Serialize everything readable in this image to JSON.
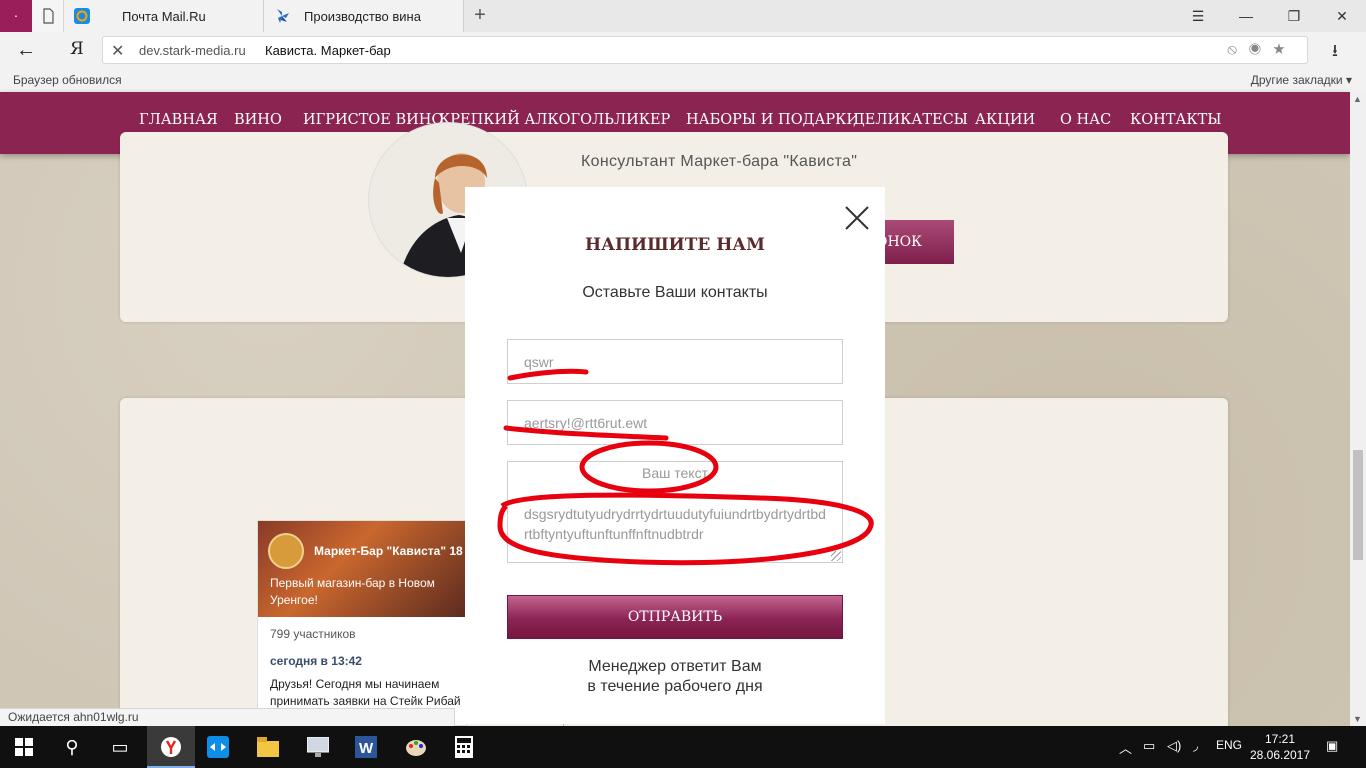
{
  "browser": {
    "tabs": [
      {
        "label": "Почта Mail.Ru",
        "icon": "mail-ru-icon"
      },
      {
        "label": "Производство вина",
        "icon": "pinwheel-icon"
      }
    ],
    "address": {
      "domain": "dev.stark-media.ru",
      "page_title": "Кависта. Маркет-бар"
    },
    "info_left": "Браузер обновился",
    "info_right": "Другие закладки"
  },
  "site": {
    "nav": [
      "ГЛАВНАЯ",
      "ВИНО",
      "ИГРИСТОЕ ВИНО",
      "КРЕПКИЙ АЛКОГОЛЬ",
      "ЛИКЕР",
      "НАБОРЫ И ПОДАРКИ",
      "ДЕЛИКАТЕСЫ",
      "АКЦИИ",
      "О НАС",
      "КОНТАКТЫ"
    ],
    "consultant": "Консультант Маркет-бара \"Кависта\"",
    "callback_button": "ОНОК",
    "vk_widget": {
      "name": "Маркет-Бар \"Кависта\" 18",
      "description": "Первый магазин-бар в Новом Уренгое!",
      "members": "799 участников",
      "date": "сегодня в 13:42",
      "post": "Друзья! Сегодня мы начинаем принимать заявки на Стейк Рибай"
    }
  },
  "modal": {
    "title": "НАПИШИТЕ НАМ",
    "subtitle": "Оставьте Ваши контакты",
    "name_value": "qswr",
    "email_value": "aertsry!@rtt6rut.ewt",
    "text_placeholder": "Ваш текст",
    "text_value": "dsgsrydtutyudrydrrtydrtuudutyfuiundrtbydrtydrtbdrtbftyntyuftunftunffnftnudbtrdr",
    "submit_label": "ОТПРАВИТЬ",
    "note_line1": "Менеджер ответит Вам",
    "note_line2": "в течение рабочего дня"
  },
  "status_text": "Ожидается ahn01wlg.ru",
  "taskbar": {
    "language": "ENG",
    "time": "17:21",
    "date": "28.06.2017"
  },
  "colors": {
    "brand": "#8c2452",
    "annotation": "#e8000f"
  }
}
